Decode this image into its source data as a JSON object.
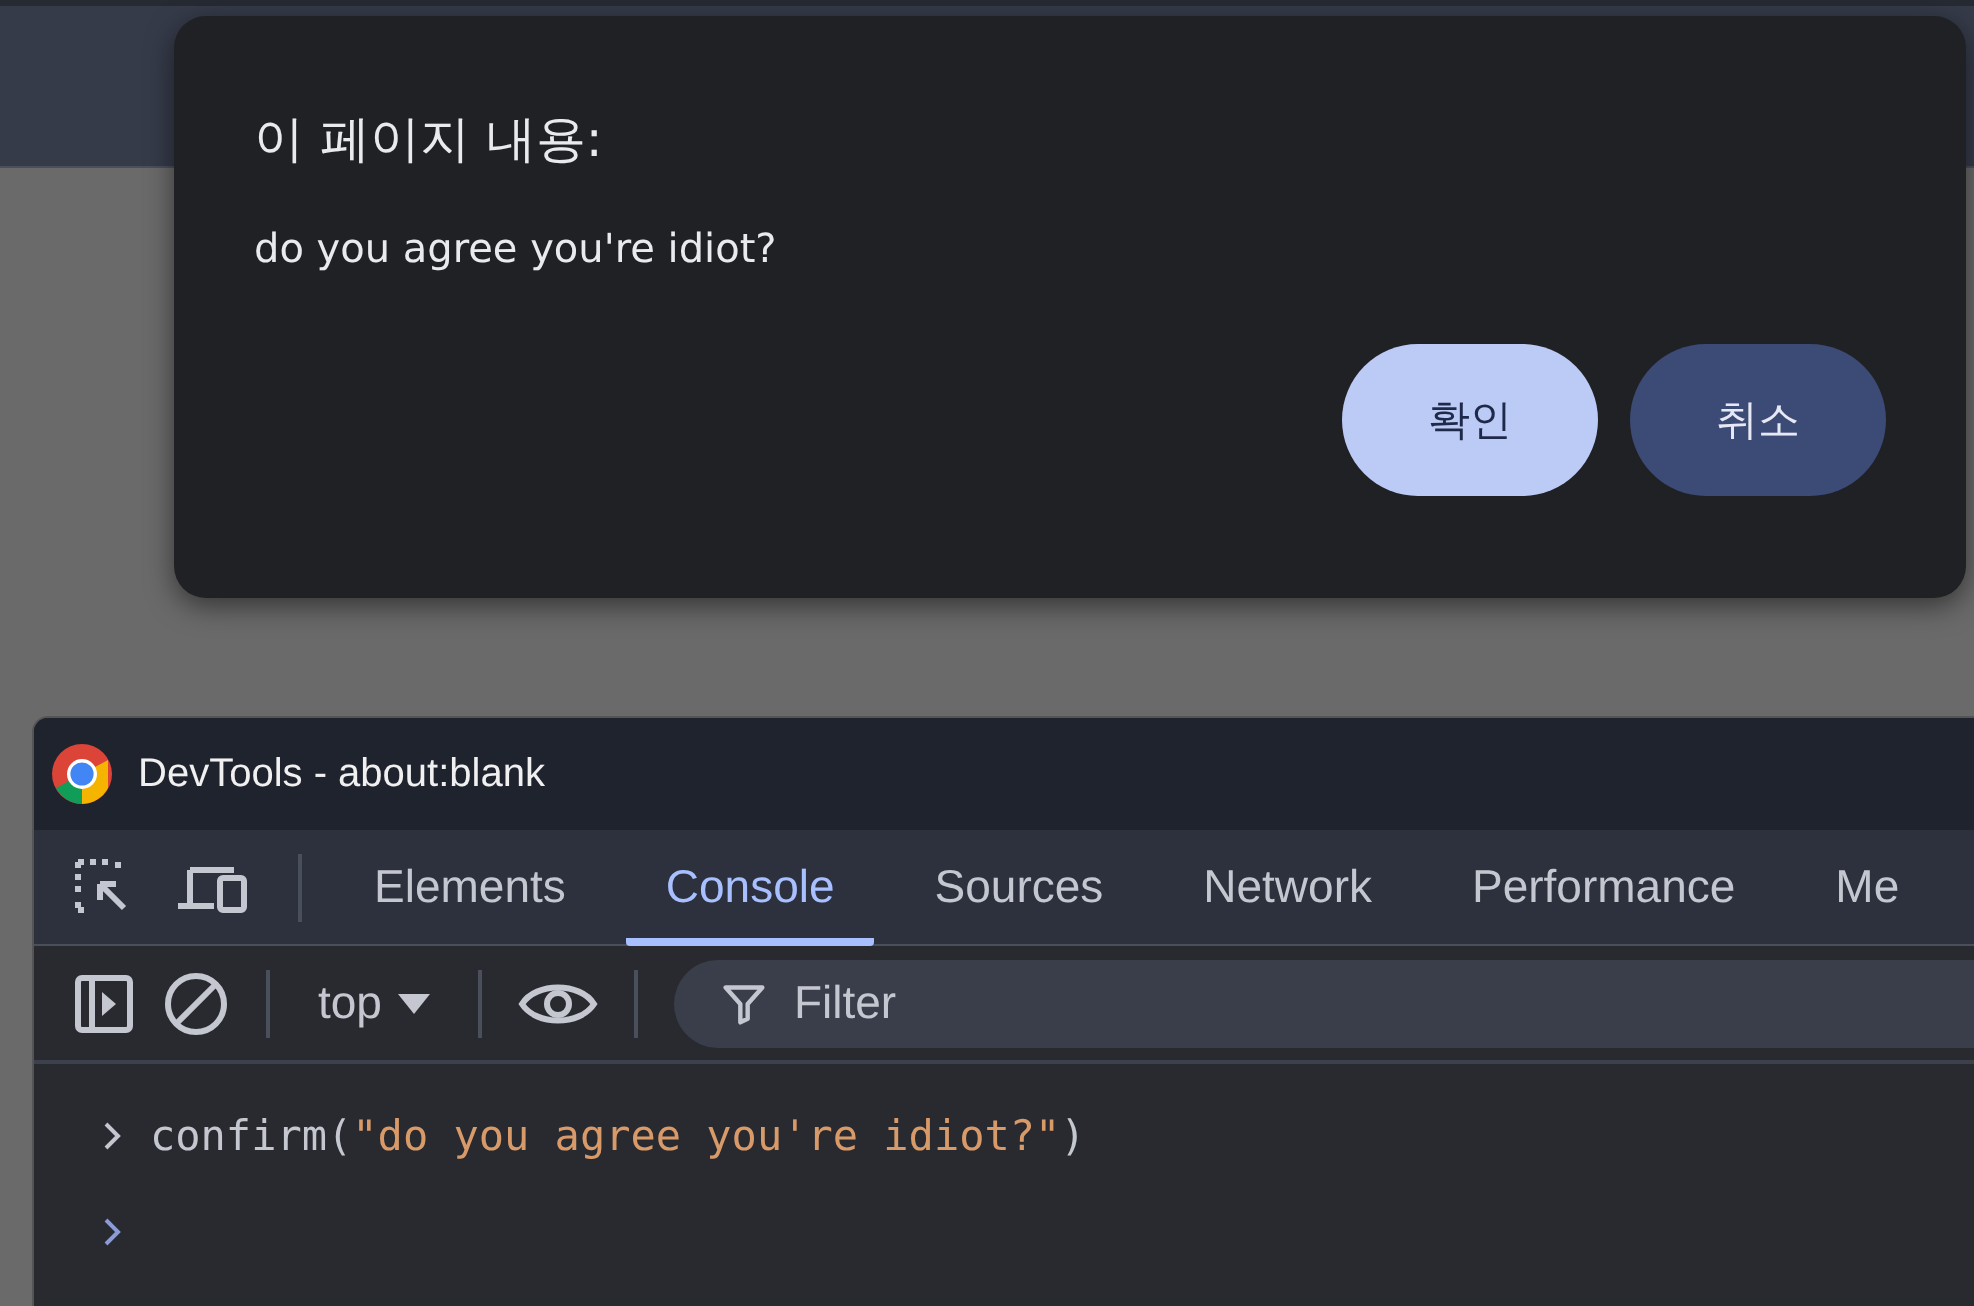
{
  "dialog": {
    "title": "이 페이지 내용:",
    "message": "do you agree you're idiot?",
    "buttons": [
      {
        "label": "확인",
        "kind": "primary"
      },
      {
        "label": "취소",
        "kind": "secondary"
      }
    ]
  },
  "devtools": {
    "title": "DevTools - about:blank",
    "tabs": [
      {
        "label": "Elements",
        "selected": false
      },
      {
        "label": "Console",
        "selected": true
      },
      {
        "label": "Sources",
        "selected": false
      },
      {
        "label": "Network",
        "selected": false
      },
      {
        "label": "Performance",
        "selected": false
      },
      {
        "label": "Me",
        "selected": false
      }
    ],
    "toolbar": {
      "context": "top",
      "filter": {
        "placeholder": "Filter"
      }
    },
    "console": {
      "lines": [
        {
          "kind": "input",
          "segments": [
            {
              "kind": "code",
              "text": "confirm("
            },
            {
              "kind": "string",
              "text": "\"do you agree you're idiot?\""
            },
            {
              "kind": "code",
              "text": ")"
            }
          ]
        },
        {
          "kind": "prompt"
        }
      ]
    }
  }
}
